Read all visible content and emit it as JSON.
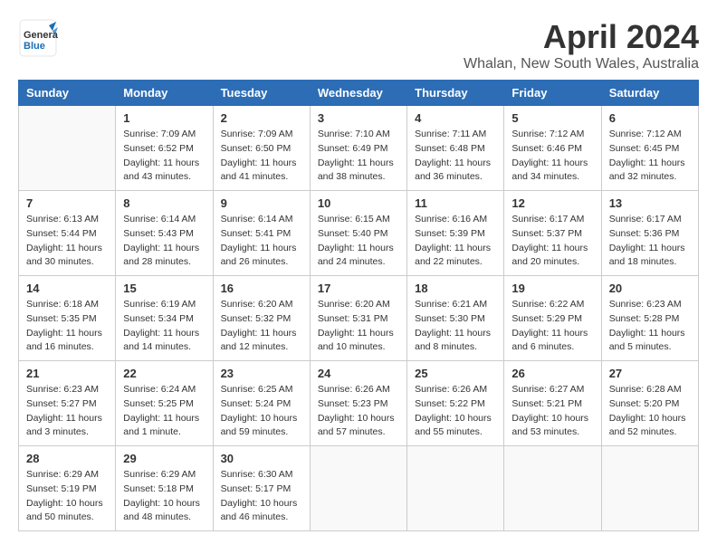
{
  "header": {
    "logo_line1": "General",
    "logo_line2": "Blue",
    "month": "April 2024",
    "location": "Whalan, New South Wales, Australia"
  },
  "weekdays": [
    "Sunday",
    "Monday",
    "Tuesday",
    "Wednesday",
    "Thursday",
    "Friday",
    "Saturday"
  ],
  "weeks": [
    [
      {
        "day": "",
        "info": ""
      },
      {
        "day": "1",
        "info": "Sunrise: 7:09 AM\nSunset: 6:52 PM\nDaylight: 11 hours\nand 43 minutes."
      },
      {
        "day": "2",
        "info": "Sunrise: 7:09 AM\nSunset: 6:50 PM\nDaylight: 11 hours\nand 41 minutes."
      },
      {
        "day": "3",
        "info": "Sunrise: 7:10 AM\nSunset: 6:49 PM\nDaylight: 11 hours\nand 38 minutes."
      },
      {
        "day": "4",
        "info": "Sunrise: 7:11 AM\nSunset: 6:48 PM\nDaylight: 11 hours\nand 36 minutes."
      },
      {
        "day": "5",
        "info": "Sunrise: 7:12 AM\nSunset: 6:46 PM\nDaylight: 11 hours\nand 34 minutes."
      },
      {
        "day": "6",
        "info": "Sunrise: 7:12 AM\nSunset: 6:45 PM\nDaylight: 11 hours\nand 32 minutes."
      }
    ],
    [
      {
        "day": "7",
        "info": "Sunrise: 6:13 AM\nSunset: 5:44 PM\nDaylight: 11 hours\nand 30 minutes."
      },
      {
        "day": "8",
        "info": "Sunrise: 6:14 AM\nSunset: 5:43 PM\nDaylight: 11 hours\nand 28 minutes."
      },
      {
        "day": "9",
        "info": "Sunrise: 6:14 AM\nSunset: 5:41 PM\nDaylight: 11 hours\nand 26 minutes."
      },
      {
        "day": "10",
        "info": "Sunrise: 6:15 AM\nSunset: 5:40 PM\nDaylight: 11 hours\nand 24 minutes."
      },
      {
        "day": "11",
        "info": "Sunrise: 6:16 AM\nSunset: 5:39 PM\nDaylight: 11 hours\nand 22 minutes."
      },
      {
        "day": "12",
        "info": "Sunrise: 6:17 AM\nSunset: 5:37 PM\nDaylight: 11 hours\nand 20 minutes."
      },
      {
        "day": "13",
        "info": "Sunrise: 6:17 AM\nSunset: 5:36 PM\nDaylight: 11 hours\nand 18 minutes."
      }
    ],
    [
      {
        "day": "14",
        "info": "Sunrise: 6:18 AM\nSunset: 5:35 PM\nDaylight: 11 hours\nand 16 minutes."
      },
      {
        "day": "15",
        "info": "Sunrise: 6:19 AM\nSunset: 5:34 PM\nDaylight: 11 hours\nand 14 minutes."
      },
      {
        "day": "16",
        "info": "Sunrise: 6:20 AM\nSunset: 5:32 PM\nDaylight: 11 hours\nand 12 minutes."
      },
      {
        "day": "17",
        "info": "Sunrise: 6:20 AM\nSunset: 5:31 PM\nDaylight: 11 hours\nand 10 minutes."
      },
      {
        "day": "18",
        "info": "Sunrise: 6:21 AM\nSunset: 5:30 PM\nDaylight: 11 hours\nand 8 minutes."
      },
      {
        "day": "19",
        "info": "Sunrise: 6:22 AM\nSunset: 5:29 PM\nDaylight: 11 hours\nand 6 minutes."
      },
      {
        "day": "20",
        "info": "Sunrise: 6:23 AM\nSunset: 5:28 PM\nDaylight: 11 hours\nand 5 minutes."
      }
    ],
    [
      {
        "day": "21",
        "info": "Sunrise: 6:23 AM\nSunset: 5:27 PM\nDaylight: 11 hours\nand 3 minutes."
      },
      {
        "day": "22",
        "info": "Sunrise: 6:24 AM\nSunset: 5:25 PM\nDaylight: 11 hours\nand 1 minute."
      },
      {
        "day": "23",
        "info": "Sunrise: 6:25 AM\nSunset: 5:24 PM\nDaylight: 10 hours\nand 59 minutes."
      },
      {
        "day": "24",
        "info": "Sunrise: 6:26 AM\nSunset: 5:23 PM\nDaylight: 10 hours\nand 57 minutes."
      },
      {
        "day": "25",
        "info": "Sunrise: 6:26 AM\nSunset: 5:22 PM\nDaylight: 10 hours\nand 55 minutes."
      },
      {
        "day": "26",
        "info": "Sunrise: 6:27 AM\nSunset: 5:21 PM\nDaylight: 10 hours\nand 53 minutes."
      },
      {
        "day": "27",
        "info": "Sunrise: 6:28 AM\nSunset: 5:20 PM\nDaylight: 10 hours\nand 52 minutes."
      }
    ],
    [
      {
        "day": "28",
        "info": "Sunrise: 6:29 AM\nSunset: 5:19 PM\nDaylight: 10 hours\nand 50 minutes."
      },
      {
        "day": "29",
        "info": "Sunrise: 6:29 AM\nSunset: 5:18 PM\nDaylight: 10 hours\nand 48 minutes."
      },
      {
        "day": "30",
        "info": "Sunrise: 6:30 AM\nSunset: 5:17 PM\nDaylight: 10 hours\nand 46 minutes."
      },
      {
        "day": "",
        "info": ""
      },
      {
        "day": "",
        "info": ""
      },
      {
        "day": "",
        "info": ""
      },
      {
        "day": "",
        "info": ""
      }
    ]
  ]
}
